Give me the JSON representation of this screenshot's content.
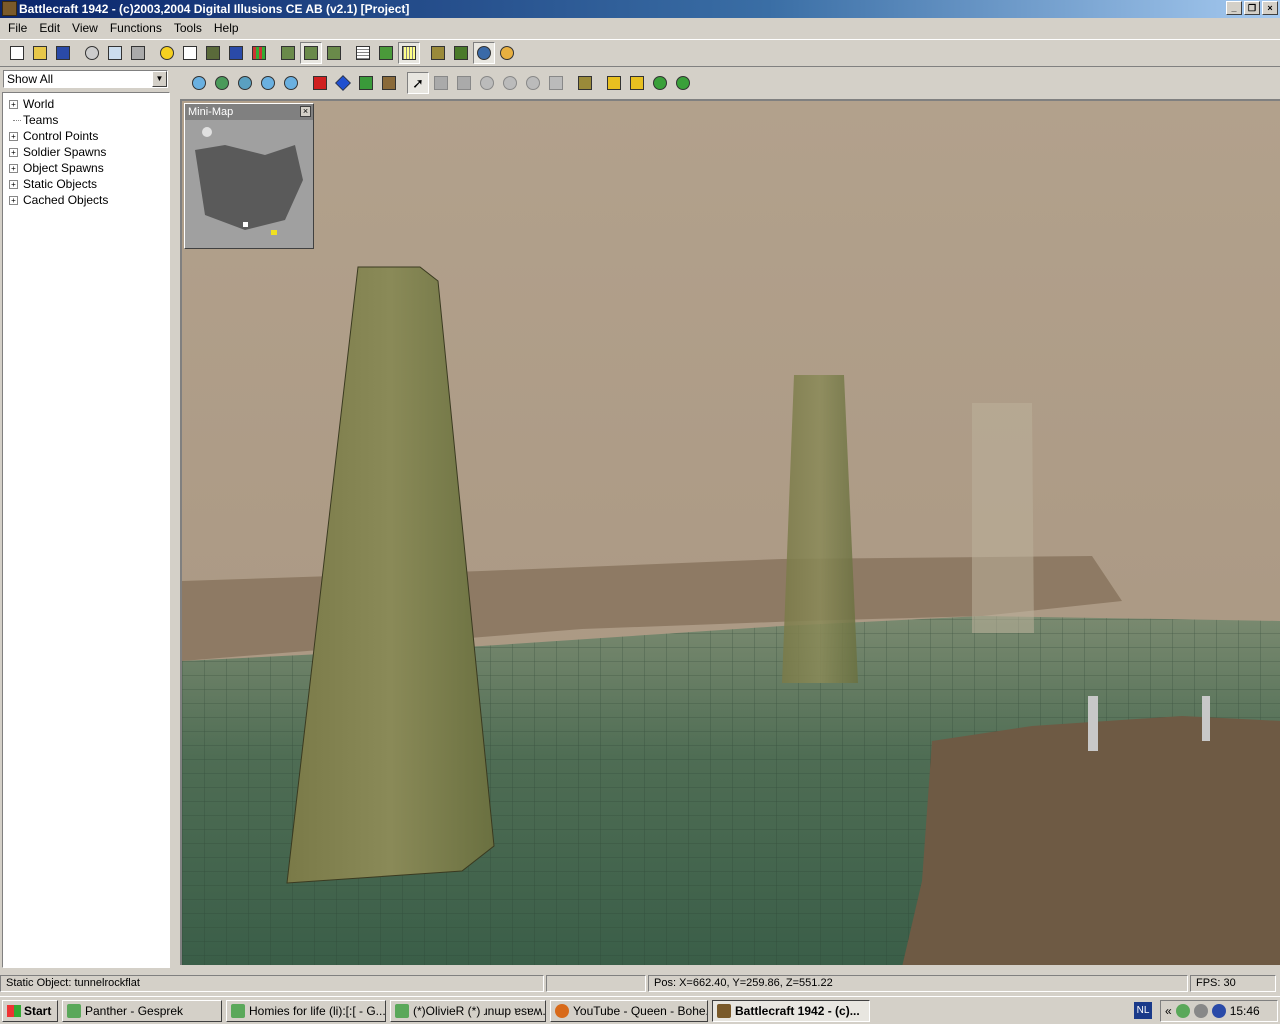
{
  "window": {
    "title": "Battlecraft 1942 - (c)2003,2004 Digital Illusions CE AB (v2.1) [Project]",
    "buttons": [
      "minimize",
      "restore",
      "close"
    ]
  },
  "menu": [
    "File",
    "Edit",
    "View",
    "Functions",
    "Tools",
    "Help"
  ],
  "sidebar": {
    "filter_value": "Show All",
    "tree": [
      {
        "label": "World",
        "expandable": true
      },
      {
        "label": "Teams",
        "expandable": false
      },
      {
        "label": "Control Points",
        "expandable": true
      },
      {
        "label": "Soldier Spawns",
        "expandable": true
      },
      {
        "label": "Object Spawns",
        "expandable": true
      },
      {
        "label": "Static Objects",
        "expandable": true
      },
      {
        "label": "Cached Objects",
        "expandable": true
      }
    ]
  },
  "minimap": {
    "title": "Mini-Map",
    "close": "×"
  },
  "status": {
    "object": "Static Object: tunnelrockflat",
    "position": "Pos: X=662.40, Y=259.86, Z=551.22",
    "fps": "FPS: 30"
  },
  "taskbar": {
    "start": "Start",
    "tasks": [
      {
        "label": "Panther - Gesprek",
        "icon_color": "#5aa85a"
      },
      {
        "label": "Homies for life (li):[:[ - G...",
        "icon_color": "#5aa85a"
      },
      {
        "label": "(*)OlivieR (*) ɹnɯp ɐsɐʍ...",
        "icon_color": "#5aa85a"
      },
      {
        "label": "YouTube - Queen - Bohe...",
        "icon_color": "#d86a1a"
      },
      {
        "label": "Battlecraft 1942 - (c)...",
        "icon_color": "#7a5a2a"
      }
    ],
    "lang": "NL",
    "tray_arrows": "«",
    "clock": "15:46"
  }
}
